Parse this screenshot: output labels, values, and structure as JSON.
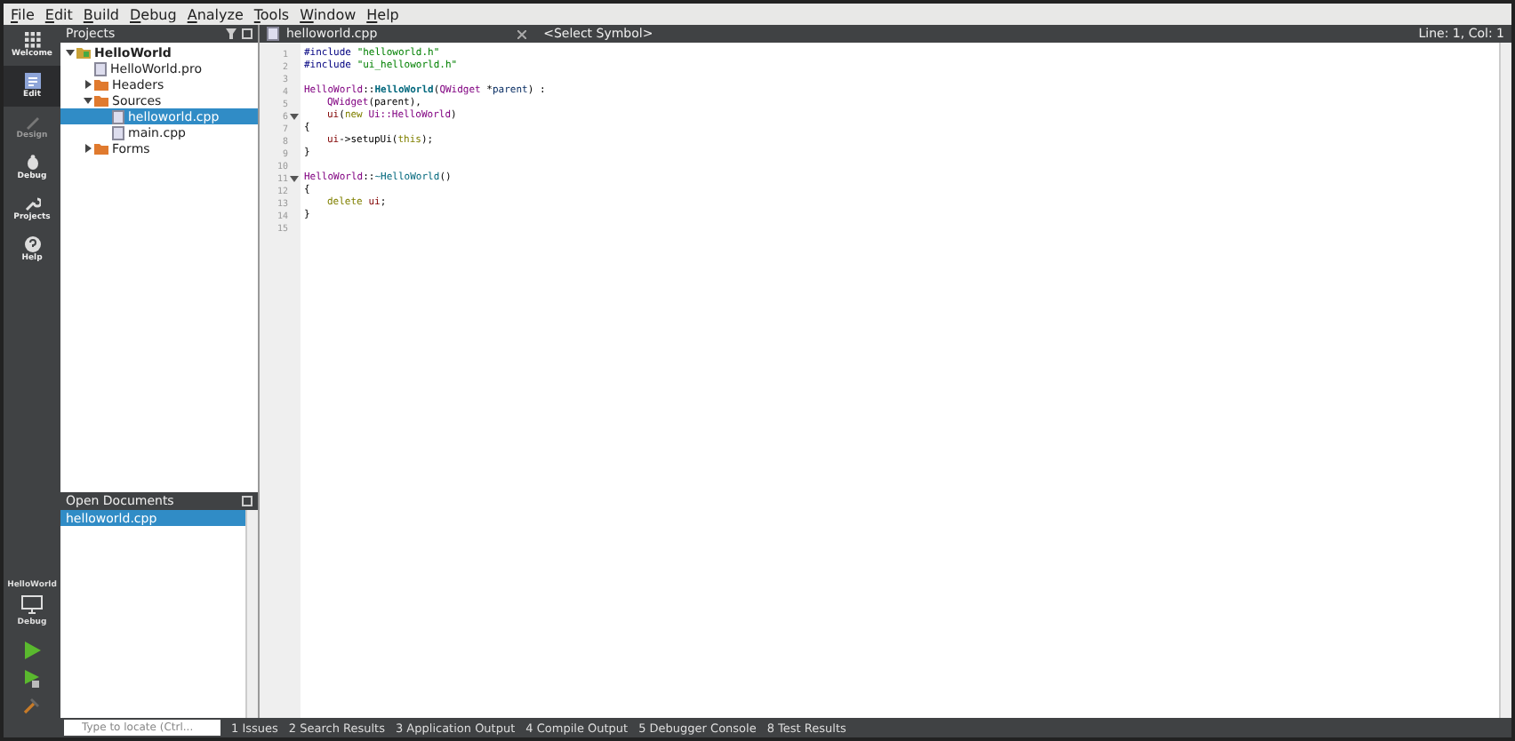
{
  "menu": [
    "File",
    "Edit",
    "Build",
    "Debug",
    "Analyze",
    "Tools",
    "Window",
    "Help"
  ],
  "modes": [
    {
      "label": "Welcome",
      "kind": "grid",
      "selected": false,
      "disabled": false
    },
    {
      "label": "Edit",
      "kind": "edit",
      "selected": true,
      "disabled": false
    },
    {
      "label": "Design",
      "kind": "pen",
      "selected": false,
      "disabled": true
    },
    {
      "label": "Debug",
      "kind": "bug",
      "selected": false,
      "disabled": false
    },
    {
      "label": "Projects",
      "kind": "wrench",
      "selected": false,
      "disabled": false
    },
    {
      "label": "Help",
      "kind": "help",
      "selected": false,
      "disabled": false
    }
  ],
  "kit": {
    "project": "HelloWorld",
    "config": "Debug"
  },
  "projects": {
    "title": "Projects",
    "tree": [
      {
        "label": "HelloWorld",
        "kind": "project",
        "expanded": true,
        "selected": false,
        "children": [
          {
            "label": "HelloWorld.pro",
            "kind": "file",
            "selected": false
          },
          {
            "label": "Headers",
            "kind": "folder",
            "expanded": false,
            "selected": false
          },
          {
            "label": "Sources",
            "kind": "folder",
            "expanded": true,
            "selected": false,
            "children": [
              {
                "label": "helloworld.cpp",
                "kind": "file",
                "selected": true
              },
              {
                "label": "main.cpp",
                "kind": "file",
                "selected": false
              }
            ]
          },
          {
            "label": "Forms",
            "kind": "folder",
            "expanded": false,
            "selected": false
          }
        ]
      }
    ]
  },
  "open_documents": {
    "title": "Open Documents",
    "items": [
      {
        "label": "helloworld.cpp",
        "selected": true
      }
    ]
  },
  "editor": {
    "file": "helloworld.cpp",
    "symbol": "<Select Symbol>",
    "position": "Line: 1, Col: 1",
    "lines": [
      {
        "number": "1",
        "fold": false,
        "tokens": [
          {
            "kind": "pre",
            "text": "#include "
          },
          {
            "kind": "str",
            "text": "\"helloworld.h\""
          }
        ]
      },
      {
        "number": "2",
        "fold": false,
        "tokens": [
          {
            "kind": "pre",
            "text": "#include "
          },
          {
            "kind": "str",
            "text": "\"ui_helloworld.h\""
          }
        ]
      },
      {
        "number": "3",
        "fold": false
      },
      {
        "number": "4",
        "fold": false,
        "tokens": [
          {
            "kind": "type",
            "text": "HelloWorld"
          },
          {
            "kind": "plain",
            "text": "::"
          },
          {
            "kind": "func",
            "text": "HelloWorld"
          },
          {
            "kind": "plain",
            "text": "("
          },
          {
            "kind": "type",
            "text": "QWidget"
          },
          {
            "kind": "plain",
            "text": " *"
          },
          {
            "kind": "param",
            "text": "parent"
          },
          {
            "kind": "plain",
            "text": ") :"
          }
        ]
      },
      {
        "number": "5",
        "fold": false,
        "indent": true,
        "tokens": [
          {
            "kind": "type",
            "text": "QWidget"
          },
          {
            "kind": "plain",
            "text": "(parent),"
          }
        ]
      },
      {
        "number": "6",
        "fold": true,
        "indent": true,
        "tokens": [
          {
            "kind": "field",
            "text": "ui"
          },
          {
            "kind": "plain",
            "text": "("
          },
          {
            "kind": "kw",
            "text": "new "
          },
          {
            "kind": "type",
            "text": "Ui::HelloWorld"
          },
          {
            "kind": "plain",
            "text": ")"
          }
        ]
      },
      {
        "number": "7",
        "fold": false,
        "tokens": [
          {
            "kind": "plain",
            "text": "{"
          }
        ]
      },
      {
        "number": "8",
        "fold": false,
        "indent": true,
        "tokens": [
          {
            "kind": "field",
            "text": "ui"
          },
          {
            "kind": "plain",
            "text": "->setupUi("
          },
          {
            "kind": "kw",
            "text": "this"
          },
          {
            "kind": "plain",
            "text": ");"
          }
        ]
      },
      {
        "number": "9",
        "fold": false,
        "tokens": [
          {
            "kind": "plain",
            "text": "}"
          }
        ]
      },
      {
        "number": "10",
        "fold": false
      },
      {
        "number": "11",
        "fold": true,
        "tokens": [
          {
            "kind": "type",
            "text": "HelloWorld"
          },
          {
            "kind": "plain",
            "text": "::"
          },
          {
            "kind": "dtor",
            "text": "~HelloWorld"
          },
          {
            "kind": "plain",
            "text": "()"
          }
        ]
      },
      {
        "number": "12",
        "fold": false,
        "tokens": [
          {
            "kind": "plain",
            "text": "{"
          }
        ]
      },
      {
        "number": "13",
        "fold": false,
        "indent": true,
        "tokens": [
          {
            "kind": "kw",
            "text": "delete "
          },
          {
            "kind": "field",
            "text": "ui"
          },
          {
            "kind": "plain",
            "text": ";"
          }
        ]
      },
      {
        "number": "14",
        "fold": false,
        "tokens": [
          {
            "kind": "plain",
            "text": "}"
          }
        ]
      },
      {
        "number": "15",
        "fold": false
      }
    ]
  },
  "locator": {
    "placeholder": "Type to locate (Ctrl..."
  },
  "output_tabs": [
    "1 Issues",
    "2 Search Results",
    "3 Application Output",
    "4 Compile Output",
    "5 Debugger Console",
    "8 Test Results"
  ]
}
